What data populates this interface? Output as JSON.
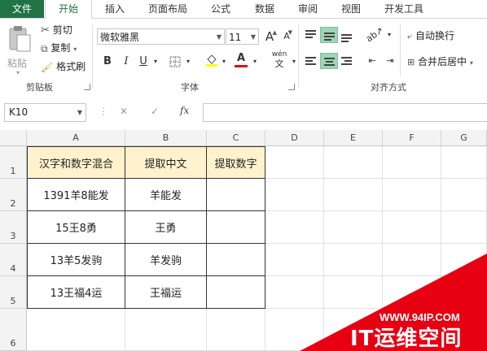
{
  "tabs": [
    "文件",
    "开始",
    "插入",
    "页面布局",
    "公式",
    "数据",
    "审阅",
    "视图",
    "开发工具"
  ],
  "clipboard": {
    "paste": "粘贴",
    "cut": "剪切",
    "copy": "复制",
    "format_painter": "格式刷",
    "group": "剪贴板"
  },
  "font": {
    "name": "微软雅黑",
    "size": "11",
    "group": "字体",
    "bold": "B",
    "italic": "I",
    "underline": "U",
    "grow": "A",
    "shrink": "A",
    "font_color_glyph": "A",
    "phonetic": "wén"
  },
  "alignment": {
    "wrap": "自动换行",
    "merge": "合并后居中",
    "group": "对齐方式"
  },
  "formula_bar": {
    "name_box": "K10",
    "cancel": "✕",
    "enter": "✓",
    "fx": "fx",
    "value": ""
  },
  "columns": [
    "A",
    "B",
    "C",
    "D",
    "E",
    "F",
    "G"
  ],
  "rows": [
    "1",
    "2",
    "3",
    "4",
    "5",
    "6"
  ],
  "table": {
    "headers": [
      "汉字和数字混合",
      "提取中文",
      "提取数字"
    ],
    "data": [
      [
        "1391羊8能发",
        "羊能发",
        ""
      ],
      [
        "15王8勇",
        "王勇",
        ""
      ],
      [
        "13羊5发驹",
        "羊发驹",
        ""
      ],
      [
        "13王福4运",
        "王福运",
        ""
      ]
    ]
  },
  "watermark": {
    "url": "WWW.94IP.COM",
    "brand": "IT运维空间"
  },
  "colors": {
    "file_tab": "#217346",
    "active_tab_text": "#217346",
    "header_fill": "#fff2cc",
    "align_on": "#9fd5b7",
    "watermark": "#e60012"
  }
}
